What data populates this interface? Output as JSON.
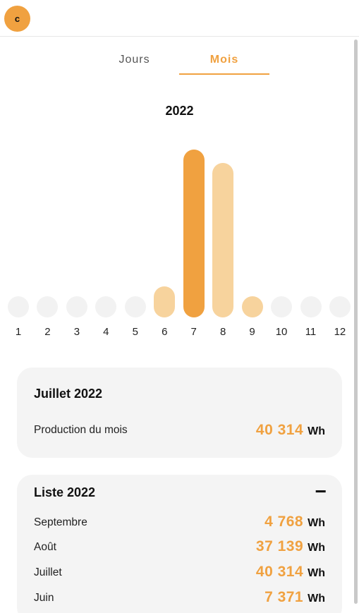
{
  "header": {
    "avatar_initial": "c"
  },
  "tabs": [
    {
      "label": "Jours",
      "active": false
    },
    {
      "label": "Mois",
      "active": true
    }
  ],
  "year": "2022",
  "chart_data": {
    "type": "bar",
    "categories": [
      "1",
      "2",
      "3",
      "4",
      "5",
      "6",
      "7",
      "8",
      "9",
      "10",
      "11",
      "12"
    ],
    "values": [
      0,
      0,
      0,
      0,
      0,
      7371,
      40314,
      37139,
      4768,
      0,
      0,
      0
    ],
    "selected_index": 6,
    "colors": {
      "selected": "#f0a140",
      "normal": "#f7d39d",
      "empty": "#f2f2f2"
    }
  },
  "selected_month": {
    "title": "Juillet 2022",
    "label": "Production du mois",
    "value": "40 314",
    "unit": "Wh"
  },
  "list": {
    "title": "Liste 2022",
    "collapse_icon": "minus-icon",
    "collapse_symbol": "−",
    "items": [
      {
        "month": "Septembre",
        "value": "4 768",
        "unit": "Wh"
      },
      {
        "month": "Août",
        "value": "37 139",
        "unit": "Wh"
      },
      {
        "month": "Juillet",
        "value": "40 314",
        "unit": "Wh"
      },
      {
        "month": "Juin",
        "value": "7 371",
        "unit": "Wh"
      }
    ]
  }
}
